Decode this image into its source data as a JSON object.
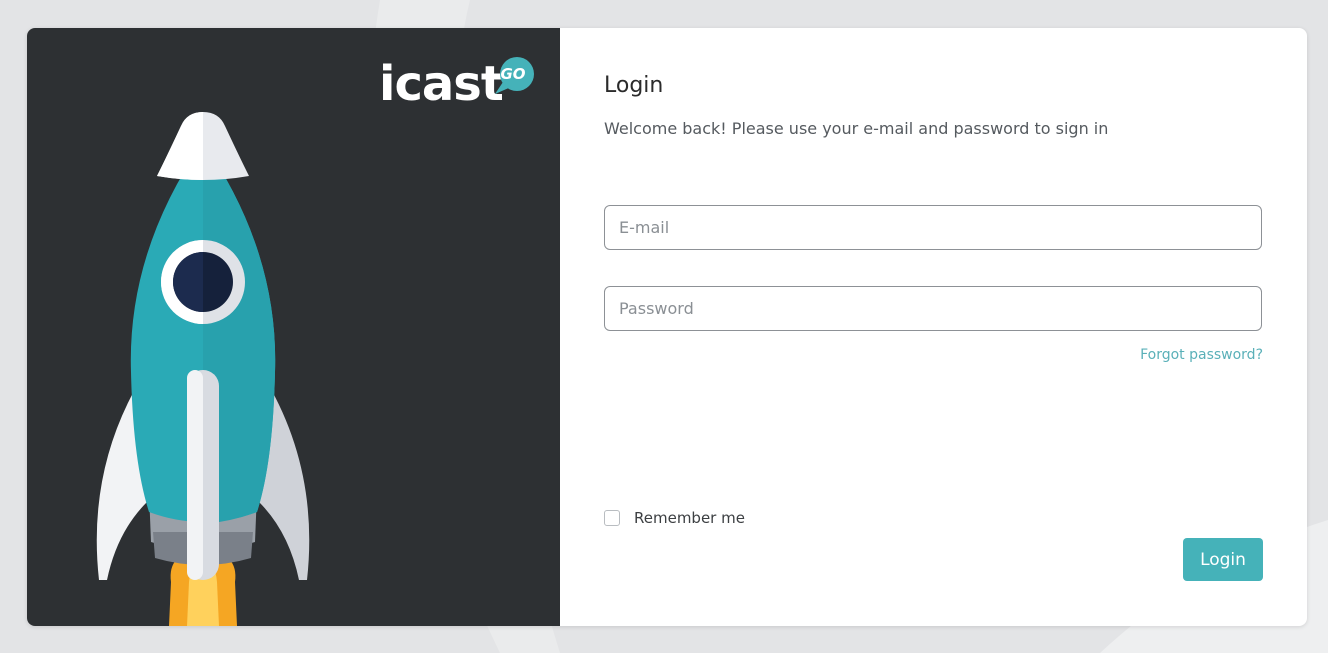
{
  "brand": {
    "name": "icast",
    "badge": "GO",
    "accent_color": "#45b2b9",
    "panel_color": "#2d3033"
  },
  "login": {
    "title": "Login",
    "subtitle": "Welcome back! Please use your e-mail and password to sign in",
    "email_placeholder": "E-mail",
    "password_placeholder": "Password",
    "forgot_password": "Forgot password?",
    "remember_me": "Remember me",
    "submit_label": "Login"
  },
  "icons": {
    "rocket": "rocket-illustration",
    "checkbox": "unchecked-checkbox"
  }
}
